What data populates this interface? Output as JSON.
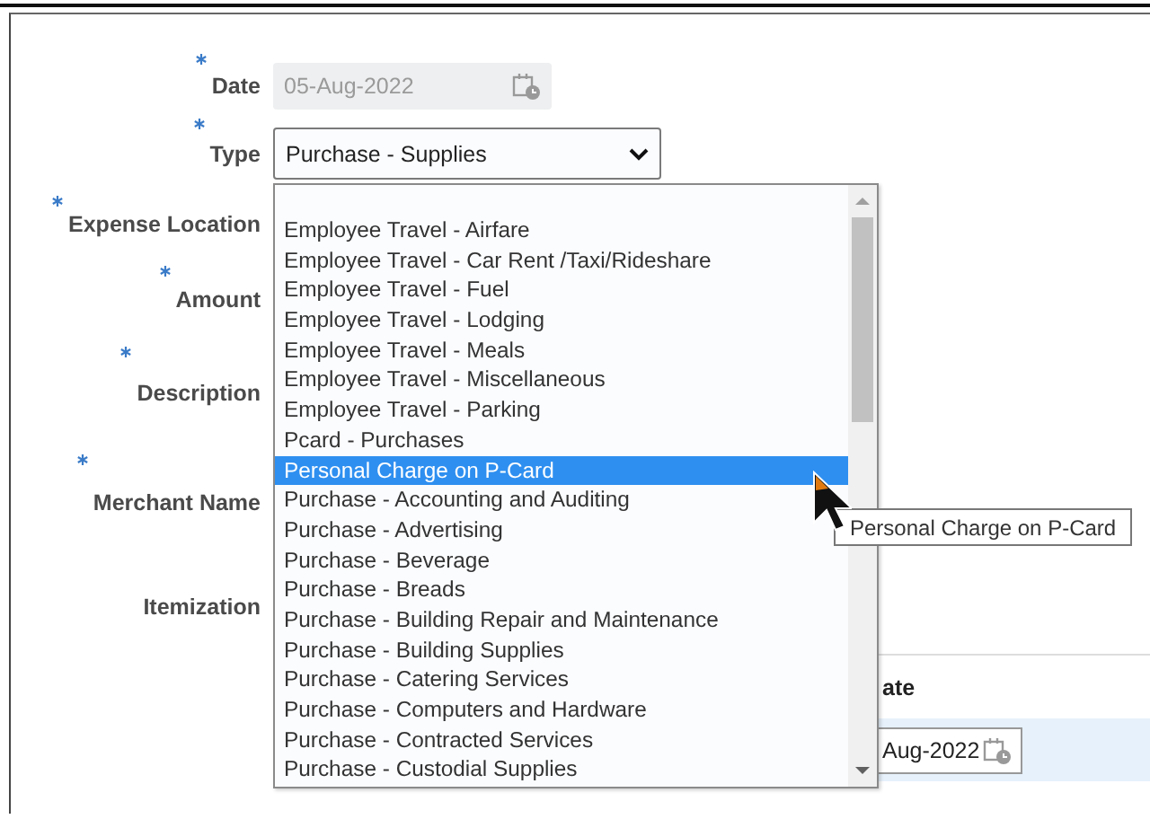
{
  "form": {
    "fields": [
      {
        "label": "Date",
        "required": true,
        "kind": "date",
        "value": "05-Aug-2022",
        "disabled": true
      },
      {
        "label": "Type",
        "required": true,
        "kind": "select",
        "value": "Purchase - Supplies",
        "disabled": false
      },
      {
        "label": "Expense Location",
        "required": true,
        "kind": "hidden"
      },
      {
        "label": "Amount",
        "required": true,
        "kind": "hidden"
      },
      {
        "label": "Description",
        "required": true,
        "kind": "hidden"
      },
      {
        "label": "Merchant Name",
        "required": true,
        "kind": "hidden"
      },
      {
        "label": "Itemization",
        "required": false,
        "kind": "hidden"
      }
    ]
  },
  "itemization_table": {
    "header": "ate",
    "row_date": "Aug-2022"
  },
  "dropdown": {
    "options": [
      {
        "label": "Employee Travel - Airfare",
        "selected": false
      },
      {
        "label": "Employee Travel - Car Rent /Taxi/Rideshare",
        "selected": false
      },
      {
        "label": "Employee Travel - Fuel",
        "selected": false
      },
      {
        "label": "Employee Travel - Lodging",
        "selected": false
      },
      {
        "label": "Employee Travel - Meals",
        "selected": false
      },
      {
        "label": "Employee Travel - Miscellaneous",
        "selected": false
      },
      {
        "label": "Employee Travel - Parking",
        "selected": false
      },
      {
        "label": "Pcard - Purchases",
        "selected": false
      },
      {
        "label": "Personal Charge on P-Card",
        "selected": true
      },
      {
        "label": "Purchase - Accounting and Auditing",
        "selected": false
      },
      {
        "label": "Purchase - Advertising",
        "selected": false
      },
      {
        "label": "Purchase - Beverage",
        "selected": false
      },
      {
        "label": "Purchase - Breads",
        "selected": false
      },
      {
        "label": "Purchase - Building Repair and Maintenance",
        "selected": false
      },
      {
        "label": "Purchase - Building Supplies",
        "selected": false
      },
      {
        "label": "Purchase - Catering Services",
        "selected": false
      },
      {
        "label": "Purchase - Computers and Hardware",
        "selected": false
      },
      {
        "label": "Purchase - Contracted Services",
        "selected": false
      },
      {
        "label": "Purchase - Custodial Supplies",
        "selected": false
      }
    ]
  },
  "tooltip": "Personal Charge on P-Card"
}
